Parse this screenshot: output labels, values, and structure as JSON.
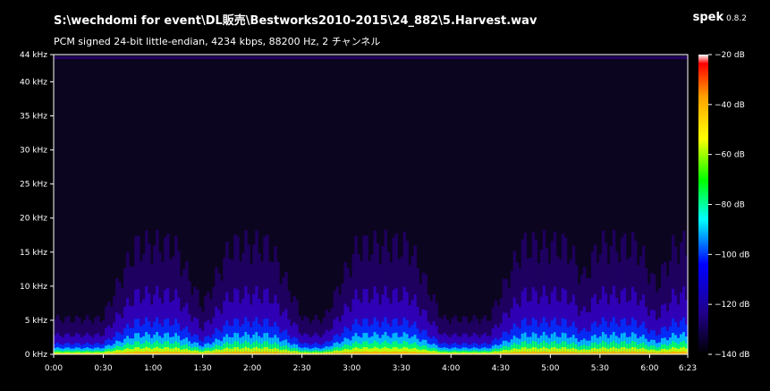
{
  "header": {
    "file_path": "S:\\wechdomi for event\\DL販売\\Bestworks2010-2015\\24_882\\5.Harvest.wav",
    "app_name": "spek",
    "app_version": "0.8.2",
    "info": "PCM signed 24-bit little-endian, 4234 kbps, 88200 Hz, 2 チャンネル"
  },
  "chart_data": {
    "type": "heatmap",
    "title": "S:\\wechdomi for event\\DL販売\\Bestworks2010-2015\\24_882\\5.Harvest.wav",
    "subtitle": "PCM signed 24-bit little-endian, 4234 kbps, 88200 Hz, 2 チャンネル",
    "y_ticks": [
      "0 kHz",
      "5 kHz",
      "10 kHz",
      "15 kHz",
      "20 kHz",
      "25 kHz",
      "30 kHz",
      "35 kHz",
      "40 kHz",
      "44 kHz"
    ],
    "y_range_khz": [
      0,
      44
    ],
    "x_ticks": [
      "0:00",
      "0:30",
      "1:00",
      "1:30",
      "2:00",
      "2:30",
      "3:00",
      "3:30",
      "4:00",
      "4:30",
      "5:00",
      "5:30",
      "6:00",
      "6:23"
    ],
    "x_range_seconds": [
      0,
      383
    ],
    "colorbar_ticks": [
      "−20 dB",
      "−40 dB",
      "−60 dB",
      "−80 dB",
      "−100 dB",
      "−120 dB",
      "−140 dB"
    ],
    "colorbar_range_db": [
      -140,
      -20
    ],
    "colors": [
      "#ffffff",
      "#ff0000",
      "#ffa000",
      "#ffff00",
      "#00ff00",
      "#00ffff",
      "#0000ff",
      "#20008a",
      "#000000"
    ]
  }
}
